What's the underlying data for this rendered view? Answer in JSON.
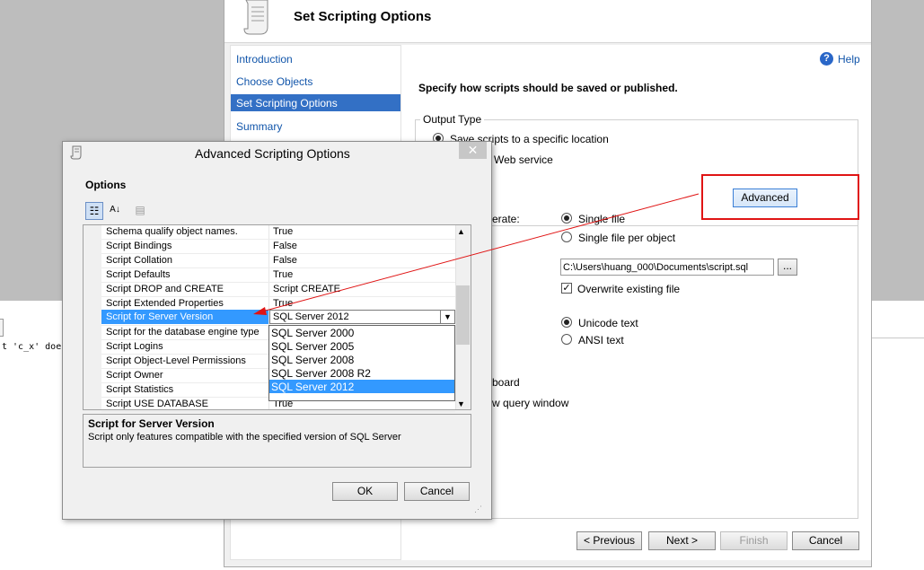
{
  "editor": {
    "text": "t 'c_x' does"
  },
  "wizard": {
    "title": "Set Scripting Options",
    "nav": {
      "items": [
        "Introduction",
        "Choose Objects",
        "Set Scripting Options",
        "Summary"
      ],
      "selected_index": 2
    },
    "help_label": "Help",
    "heading": "Specify how scripts should be saved or published.",
    "output_type": {
      "label": "Output Type",
      "option1": "Save scripts to a specific location",
      "option2_partial": "Web service"
    },
    "advanced_button": "Advanced",
    "files_to_generate_partial": "erate:",
    "single_file": "Single file",
    "single_file_per_object": "Single file per object",
    "file_path": "C:\\Users\\huang_000\\Documents\\script.sql",
    "browse_button": "...",
    "overwrite_label": "Overwrite existing file",
    "unicode_label": "Unicode text",
    "ansi_label": "ANSI text",
    "clipboard_partial": "board",
    "query_window_partial": "w query window",
    "buttons": {
      "previous": "< Previous",
      "next": "Next >",
      "finish": "Finish",
      "cancel": "Cancel"
    }
  },
  "dialog": {
    "title": "Advanced Scripting Options",
    "close": "✕",
    "options_label": "Options",
    "rows": [
      {
        "name": "Schema qualify object names.",
        "value": "True"
      },
      {
        "name": "Script Bindings",
        "value": "False"
      },
      {
        "name": "Script Collation",
        "value": "False"
      },
      {
        "name": "Script Defaults",
        "value": "True"
      },
      {
        "name": "Script DROP and CREATE",
        "value": "Script CREATE"
      },
      {
        "name": "Script Extended Properties",
        "value": "True"
      },
      {
        "name": "Script for Server Version",
        "value": "SQL Server 2012"
      },
      {
        "name": "Script for the database engine type",
        "value": ""
      },
      {
        "name": "Script Logins",
        "value": ""
      },
      {
        "name": "Script Object-Level Permissions",
        "value": ""
      },
      {
        "name": "Script Owner",
        "value": ""
      },
      {
        "name": "Script Statistics",
        "value": ""
      },
      {
        "name": "Script USE DATABASE",
        "value": "True"
      }
    ],
    "dropdown_options": [
      "SQL Server 2000",
      "SQL Server 2005",
      "SQL Server 2008",
      "SQL Server 2008 R2",
      "SQL Server 2012"
    ],
    "dropdown_selected_index": 4,
    "description_title": "Script for Server Version",
    "description_text": "Script only features compatible with the specified version of SQL Server",
    "ok_button": "OK",
    "cancel_button": "Cancel"
  },
  "colors": {
    "selection": "#3399ff",
    "nav_selection": "#3370c5",
    "annotation": "#e01414"
  }
}
